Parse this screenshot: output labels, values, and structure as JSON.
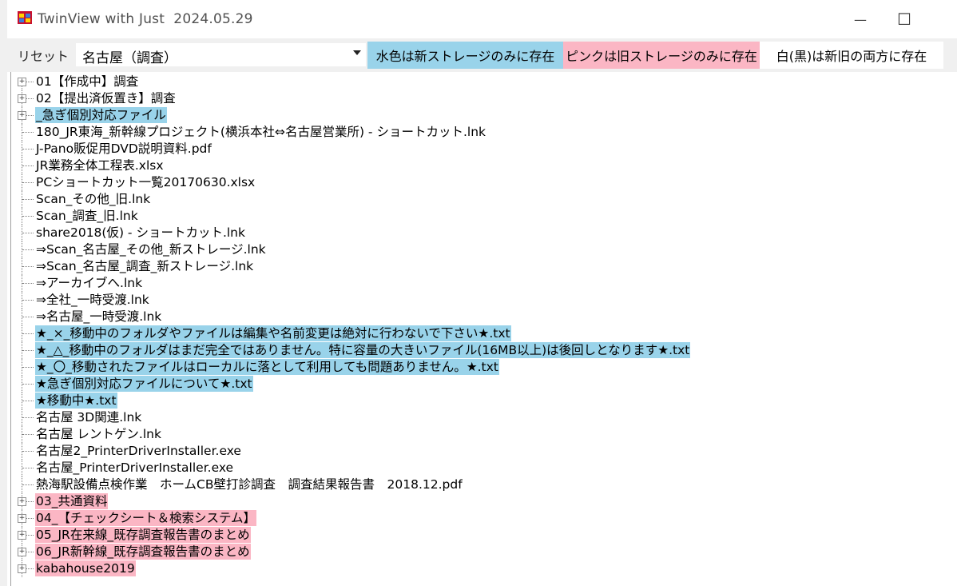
{
  "window": {
    "title": "TwinView with Just  2024.05.29",
    "minimize_glyph": "—",
    "maximize_glyph": "☐"
  },
  "toolbar": {
    "reset_label": "リセット",
    "location_value": "名古屋（調査）",
    "legend_new_only": "水色は新ストレージのみに存在",
    "legend_old_only": "ピンクは旧ストレージのみに存在",
    "legend_both": "白(黒)は新旧の両方に存在"
  },
  "colors": {
    "new_only_bg": "#99d3ea",
    "old_only_bg": "#fbb6c4",
    "annotation_red": "#e3061a"
  },
  "tree": [
    {
      "label": "01【作成中】調査",
      "folder": true,
      "status": "both"
    },
    {
      "label": "02【提出済仮置き】調査",
      "folder": true,
      "status": "both"
    },
    {
      "label": "_急ぎ個別対応ファイル",
      "folder": true,
      "status": "new"
    },
    {
      "label": "180_JR東海_新幹線プロジェクト(横浜本社⇔名古屋営業所) - ショートカット.lnk",
      "folder": false,
      "status": "both"
    },
    {
      "label": "J-Pano販促用DVD説明資料.pdf",
      "folder": false,
      "status": "both"
    },
    {
      "label": "JR業務全体工程表.xlsx",
      "folder": false,
      "status": "both"
    },
    {
      "label": "PCショートカット一覧20170630.xlsx",
      "folder": false,
      "status": "both"
    },
    {
      "label": "Scan_その他_旧.lnk",
      "folder": false,
      "status": "both"
    },
    {
      "label": "Scan_調査_旧.lnk",
      "folder": false,
      "status": "both"
    },
    {
      "label": "share2018(仮) - ショートカット.lnk",
      "folder": false,
      "status": "both"
    },
    {
      "label": "⇒Scan_名古屋_その他_新ストレージ.lnk",
      "folder": false,
      "status": "both"
    },
    {
      "label": "⇒Scan_名古屋_調査_新ストレージ.lnk",
      "folder": false,
      "status": "both"
    },
    {
      "label": "⇒アーカイブへ.lnk",
      "folder": false,
      "status": "both"
    },
    {
      "label": "⇒全社_一時受渡.lnk",
      "folder": false,
      "status": "both"
    },
    {
      "label": "⇒名古屋_一時受渡.lnk",
      "folder": false,
      "status": "both"
    },
    {
      "label": "★_×_移動中のフォルダやファイルは編集や名前変更は絶対に行わないで下さい★.txt",
      "folder": false,
      "status": "new"
    },
    {
      "label": "★_△_移動中のフォルダはまだ完全ではありません。特に容量の大きいファイル(16MB以上)は後回しとなります★.txt",
      "folder": false,
      "status": "new"
    },
    {
      "label": "★_〇_移動されたファイルはローカルに落として利用しても問題ありません。★.txt",
      "folder": false,
      "status": "new"
    },
    {
      "label": "★急ぎ個別対応ファイルについて★.txt",
      "folder": false,
      "status": "new"
    },
    {
      "label": "★移動中★.txt",
      "folder": false,
      "status": "new"
    },
    {
      "label": "名古屋 3D関連.lnk",
      "folder": false,
      "status": "both"
    },
    {
      "label": "名古屋 レントゲン.lnk",
      "folder": false,
      "status": "both"
    },
    {
      "label": "名古屋2_PrinterDriverInstaller.exe",
      "folder": false,
      "status": "both"
    },
    {
      "label": "名古屋_PrinterDriverInstaller.exe",
      "folder": false,
      "status": "both"
    },
    {
      "label": "熱海駅設備点検作業　ホームCB壁打診調査　調査結果報告書　2018.12.pdf",
      "folder": false,
      "status": "both"
    },
    {
      "label": "03_共通資料",
      "folder": true,
      "status": "old"
    },
    {
      "label": "04_【チェックシート＆検索システム】",
      "folder": true,
      "status": "old"
    },
    {
      "label": "05_JR在来線_既存調査報告書のまとめ",
      "folder": true,
      "status": "old"
    },
    {
      "label": "06_JR新幹線_既存調査報告書のまとめ",
      "folder": true,
      "status": "old"
    },
    {
      "label": "kabahouse2019",
      "folder": true,
      "status": "old"
    }
  ]
}
